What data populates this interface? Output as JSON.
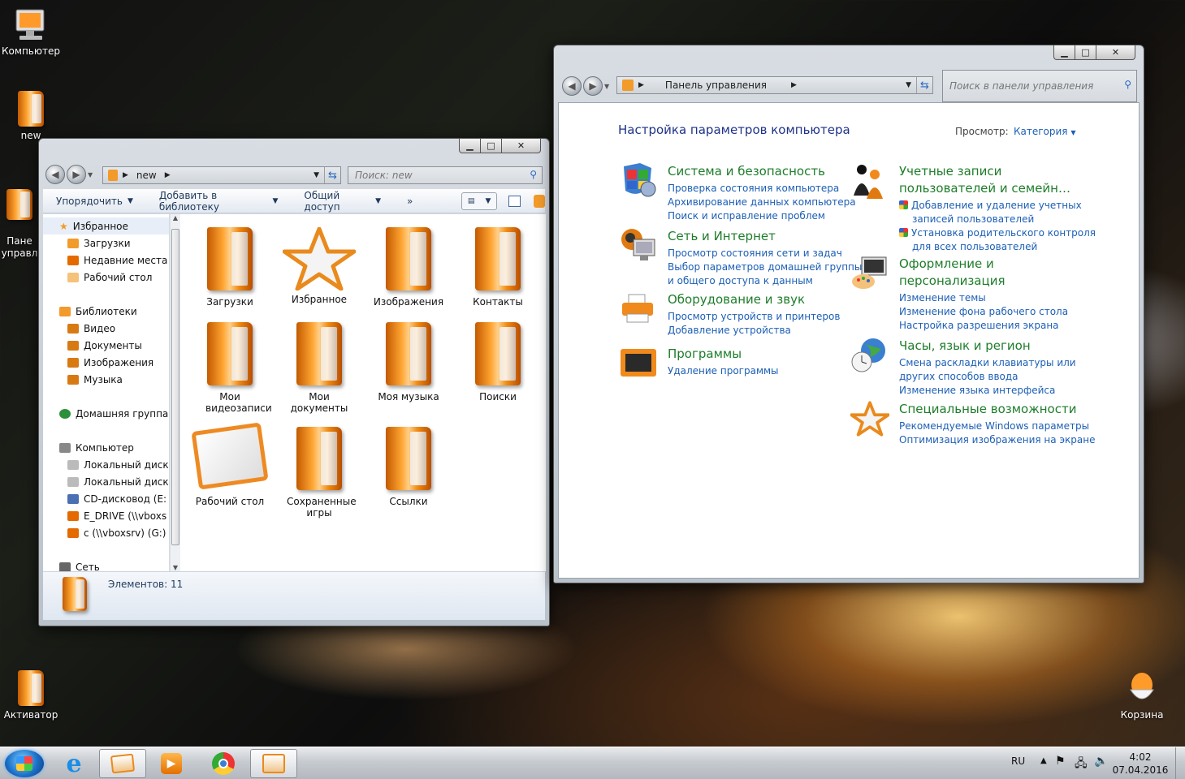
{
  "desktop": {
    "icons": {
      "computer": "Компьютер",
      "new": "new",
      "control_panel": "Пане\nуправл",
      "activator": "Активатор",
      "recycle_bin": "Корзина"
    }
  },
  "explorer": {
    "address": "new",
    "search_placeholder": "Поиск: new",
    "toolbar": {
      "organize": "Упорядочить",
      "add_library": "Добавить в библиотеку",
      "share": "Общий доступ",
      "more": "»"
    },
    "nav": {
      "favorites_header": "Избранное",
      "favorites": [
        "Загрузки",
        "Недавние места",
        "Рабочий стол"
      ],
      "libraries_header": "Библиотеки",
      "libraries": [
        "Видео",
        "Документы",
        "Изображения",
        "Музыка"
      ],
      "homegroup": "Домашняя группа",
      "computer_header": "Компьютер",
      "drives": [
        "Локальный диск",
        "Локальный диск",
        "CD-дисковод (E:",
        "E_DRIVE (\\\\vboxs",
        "c (\\\\vboxsrv) (G:)"
      ],
      "network": "Сеть"
    },
    "items": [
      {
        "label": "Загрузки",
        "icon": "downloads-folder-icon"
      },
      {
        "label": "Избранное",
        "icon": "favorites-star-icon"
      },
      {
        "label": "Изображения",
        "icon": "pictures-folder-icon"
      },
      {
        "label": "Контакты",
        "icon": "contacts-folder-icon"
      },
      {
        "label": "Мои видеозаписи",
        "icon": "videos-folder-icon"
      },
      {
        "label": "Мои документы",
        "icon": "documents-folder-icon"
      },
      {
        "label": "Моя музыка",
        "icon": "music-folder-icon"
      },
      {
        "label": "Поиски",
        "icon": "searches-folder-icon"
      },
      {
        "label": "Рабочий стол",
        "icon": "desktop-folder-icon"
      },
      {
        "label": "Сохраненные игры",
        "icon": "saved-games-folder-icon"
      },
      {
        "label": "Ссылки",
        "icon": "links-folder-icon"
      }
    ],
    "status": "Элементов: 11"
  },
  "control_panel": {
    "address": "Панель управления",
    "search_placeholder": "Поиск в панели управления",
    "title": "Настройка параметров компьютера",
    "view_label": "Просмотр:",
    "view_value": "Категория",
    "categories_left": [
      {
        "title": "Система и безопасность",
        "links": [
          "Проверка состояния компьютера",
          "Архивирование данных компьютера",
          "Поиск и исправление проблем"
        ],
        "icon": "security-shield-icon"
      },
      {
        "title": "Сеть и Интернет",
        "links": [
          "Просмотр состояния сети и задач",
          "Выбор параметров домашней группы",
          "и общего доступа к данным"
        ],
        "icon": "network-globe-icon"
      },
      {
        "title": "Оборудование и звук",
        "links": [
          "Просмотр устройств и принтеров",
          "Добавление устройства"
        ],
        "icon": "printer-icon"
      },
      {
        "title": "Программы",
        "links": [
          "Удаление программы"
        ],
        "icon": "programs-icon"
      }
    ],
    "categories_right": [
      {
        "title1": "Учетные записи",
        "title2": "пользователей и семейн…",
        "links": [
          "Добавление и удаление учетных",
          "записей пользователей",
          "Установка родительского контроля",
          "для всех пользователей"
        ],
        "icon": "users-icon"
      },
      {
        "title1": "Оформление и",
        "title2": "персонализация",
        "links": [
          "Изменение темы",
          "Изменение фона рабочего стола",
          "Настройка разрешения экрана"
        ],
        "icon": "appearance-icon"
      },
      {
        "title": "Часы, язык и регион",
        "links": [
          "Смена раскладки клавиатуры или",
          "других способов ввода",
          "Изменение языка интерфейса"
        ],
        "icon": "clock-globe-icon"
      },
      {
        "title": "Специальные возможности",
        "links": [
          "Рекомендуемые Windows параметры",
          "Оптимизация изображения на экране"
        ],
        "icon": "accessibility-star-icon"
      }
    ]
  },
  "taskbar": {
    "lang": "RU",
    "time": "4:02",
    "date": "07.04.2016"
  }
}
